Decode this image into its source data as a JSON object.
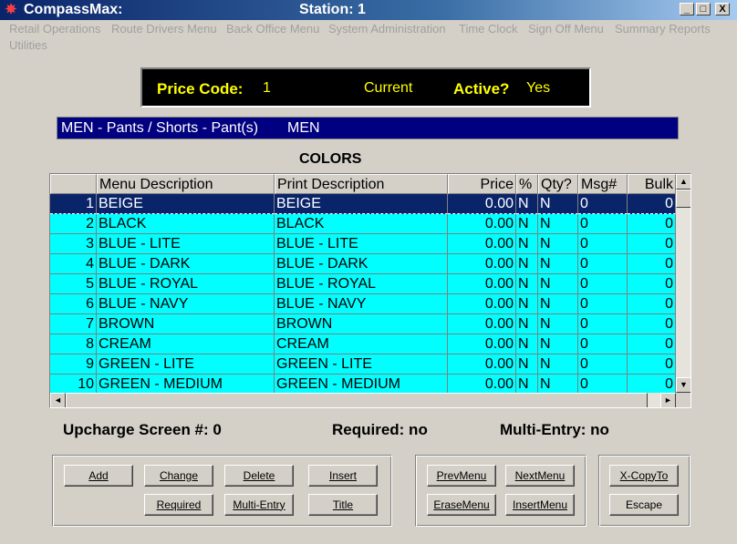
{
  "window": {
    "app_title": "CompassMax:",
    "station": "Station: 1",
    "min_label": "_",
    "max_label": "□",
    "close_label": "X"
  },
  "menu": [
    "Retail Operations",
    "Route Drivers Menu",
    "Back Office Menu",
    "System Administration",
    "Time Clock",
    "Sign Off Menu",
    "Summary Reports",
    "Utilities"
  ],
  "price_info": {
    "price_code_label": "Price Code:",
    "price_code_value": "1",
    "status": "Current",
    "active_label": "Active?",
    "active_value": "Yes"
  },
  "category": {
    "path": "MEN - Pants / Shorts - Pant(s)",
    "group": "MEN"
  },
  "section_title": "COLORS",
  "table": {
    "headers": [
      "",
      "Menu Description",
      "Print Description",
      "Price",
      "%",
      "Qty?",
      "Msg#",
      "Bulk"
    ],
    "rows": [
      [
        "1",
        "BEIGE",
        "BEIGE",
        "0.00",
        "N",
        "N",
        "0",
        "0"
      ],
      [
        "2",
        "BLACK",
        "BLACK",
        "0.00",
        "N",
        "N",
        "0",
        "0"
      ],
      [
        "3",
        "BLUE - LITE",
        "BLUE - LITE",
        "0.00",
        "N",
        "N",
        "0",
        "0"
      ],
      [
        "4",
        "BLUE - DARK",
        "BLUE - DARK",
        "0.00",
        "N",
        "N",
        "0",
        "0"
      ],
      [
        "5",
        "BLUE - ROYAL",
        "BLUE - ROYAL",
        "0.00",
        "N",
        "N",
        "0",
        "0"
      ],
      [
        "6",
        "BLUE - NAVY",
        "BLUE - NAVY",
        "0.00",
        "N",
        "N",
        "0",
        "0"
      ],
      [
        "7",
        "BROWN",
        "BROWN",
        "0.00",
        "N",
        "N",
        "0",
        "0"
      ],
      [
        "8",
        "CREAM",
        "CREAM",
        "0.00",
        "N",
        "N",
        "0",
        "0"
      ],
      [
        "9",
        "GREEN - LITE",
        "GREEN - LITE",
        "0.00",
        "N",
        "N",
        "0",
        "0"
      ],
      [
        "10",
        "GREEN - MEDIUM",
        "GREEN - MEDIUM",
        "0.00",
        "N",
        "N",
        "0",
        "0"
      ]
    ],
    "selected_row": 0
  },
  "info": {
    "upcharge": "Upcharge Screen #: 0",
    "required": "Required: no",
    "multi_entry": "Multi-Entry: no"
  },
  "buttons": {
    "add": "Add",
    "change": "Change",
    "delete": "Delete",
    "insert": "Insert",
    "required": "Required",
    "multi_entry": "Multi-Entry",
    "title": "Title",
    "prev_menu": "PrevMenu",
    "next_menu": "NextMenu",
    "erase_menu": "EraseMenu",
    "insert_menu": "InsertMenu",
    "x_copy_to": "X-CopyTo",
    "escape": "Escape"
  },
  "colors": {
    "row_bg": "#00ffff",
    "selected_bg": "#0a246a",
    "category_bg": "#000080",
    "price_text": "#ffff00"
  }
}
